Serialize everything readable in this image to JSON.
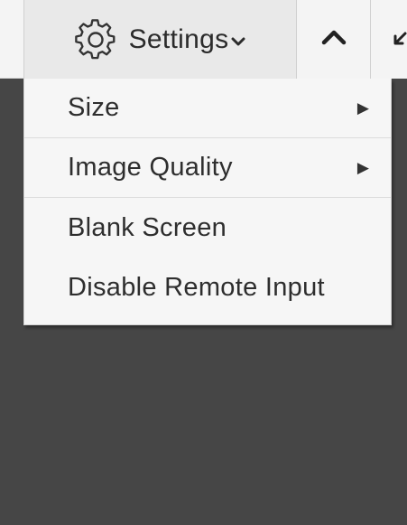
{
  "toolbar": {
    "settings_label": "Settings",
    "settings_icon": "gear-icon",
    "settings_chevron_icon": "chevron-down-icon",
    "collapse_icon": "chevron-up-icon",
    "fullscreen_icon": "expand-arrows-icon"
  },
  "menu": {
    "items": [
      {
        "label": "Size",
        "has_submenu": true
      },
      {
        "label": "Image Quality",
        "has_submenu": true
      },
      {
        "label": "Blank Screen",
        "has_submenu": false
      },
      {
        "label": "Disable Remote Input",
        "has_submenu": false
      }
    ],
    "submenu_glyph": "▶"
  },
  "colors": {
    "toolbar_bg": "#f4f4f4",
    "active_button_bg": "#e9e9e9",
    "menu_bg": "#f6f6f6",
    "canvas_bg": "#464646",
    "text": "#2e2e2e"
  }
}
